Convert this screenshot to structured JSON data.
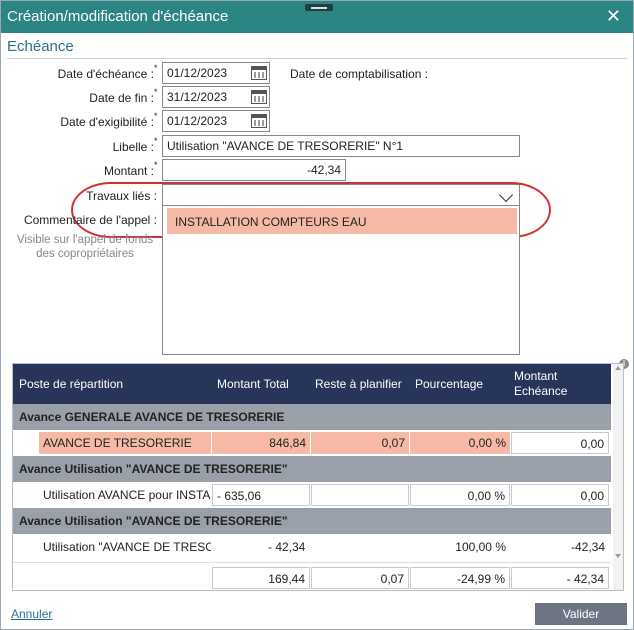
{
  "window": {
    "title": "Création/modification d'échéance"
  },
  "section_title": "Echéance",
  "form": {
    "date_echeance_label": "Date d'échéance :",
    "date_echeance_value": "01/12/2023",
    "date_comptabilisation_label": "Date de comptabilisation :",
    "date_fin_label": "Date de fin :",
    "date_fin_value": "31/12/2023",
    "date_exigibilite_label": "Date d'exigibilité :",
    "date_exigibilite_value": "01/12/2023",
    "libelle_label": "Libelle :",
    "libelle_value": "Utilisation \"AVANCE DE TRESORERIE\" N°1",
    "montant_label": "Montant :",
    "montant_value": "-42,34",
    "travaux_label": "Travaux liés :",
    "travaux_value": "",
    "travaux_option": "INSTALLATION COMPTEURS EAU",
    "commentaire_label": "Commentaire de l'appel :",
    "commentaire_hint": "Visible sur l'appel de fonds des copropriétaires",
    "required_mark": "*"
  },
  "grid": {
    "headers": {
      "poste": "Poste de répartition",
      "montant_total": "Montant Total",
      "reste": "Reste à planifier",
      "pourcentage": "Pourcentage",
      "montant_echeance_1": "Montant",
      "montant_echeance_2": "Echéance"
    },
    "groups": [
      {
        "title": "Avance GENERALE AVANCE DE TRESORERIE",
        "row": {
          "poste": "AVANCE DE TRESORERIE",
          "total": "846,84",
          "reste": "0,07",
          "pct": "0,00 %",
          "echeance": "0,00"
        }
      },
      {
        "title": "Avance Utilisation \"AVANCE DE TRESORERIE\"",
        "row": {
          "poste": "Utilisation AVANCE pour INSTA...",
          "total": "-  635,06",
          "reste": "",
          "pct": "0,00 %",
          "echeance": "0,00"
        }
      },
      {
        "title": "Avance Utilisation \"AVANCE DE TRESORERIE\"",
        "row": {
          "poste": "Utilisation \"AVANCE DE TRESO...",
          "total": "-  42,34",
          "reste": "",
          "pct": "100,00 %",
          "echeance": "-42,34"
        }
      }
    ],
    "totals": {
      "total": "169,44",
      "reste": "0,07",
      "pct": "-24,99 %",
      "echeance": "-  42,34"
    }
  },
  "footer": {
    "cancel_label": "Annuler",
    "validate_label": "Valider"
  },
  "colors": {
    "titlebar": "#2b8583",
    "grid_header": "#27355b",
    "highlight": "#f5b9a6",
    "annotation": "#d2322f"
  },
  "icons": [
    "calendar-icon",
    "chevron-down-icon",
    "close-icon",
    "info-icon"
  ]
}
